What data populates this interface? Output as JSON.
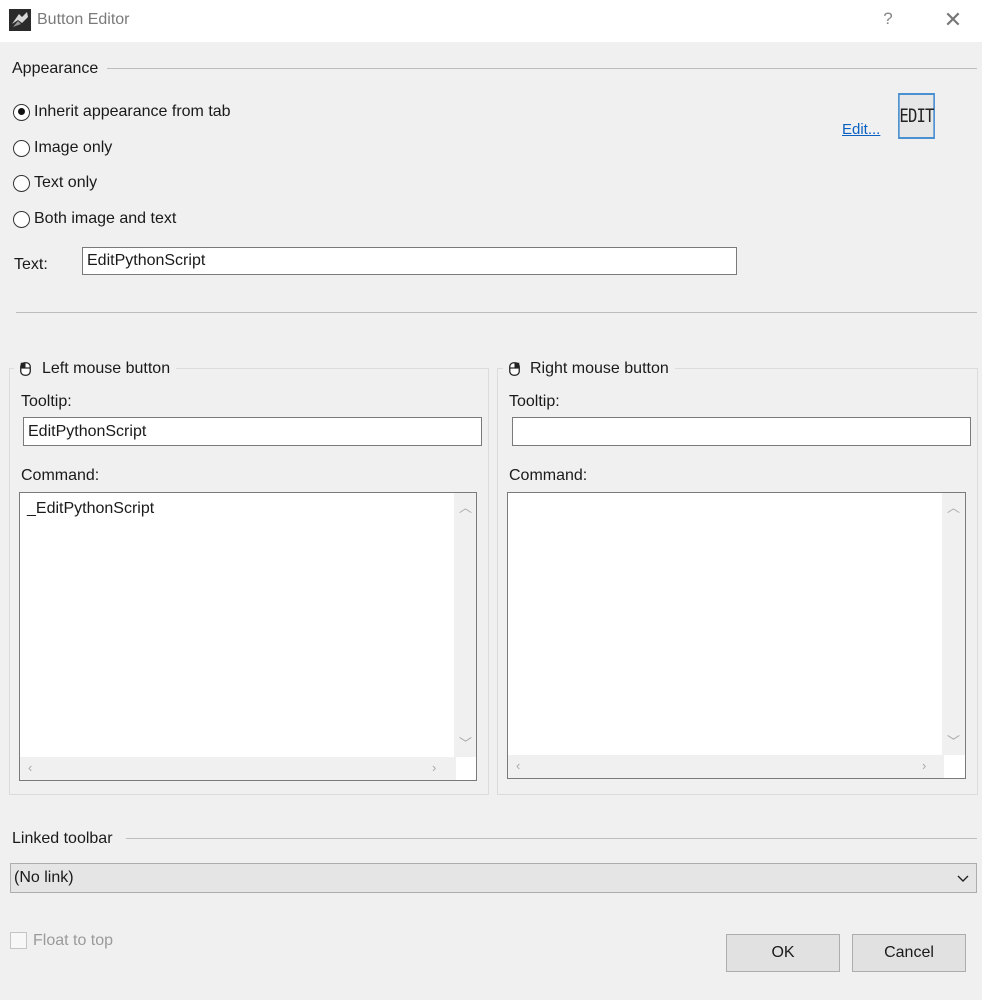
{
  "window": {
    "title": "Button Editor",
    "help_label": "?",
    "close_label": "✕"
  },
  "appearance": {
    "group_label": "Appearance",
    "options": [
      {
        "label": "Inherit appearance from tab",
        "checked": true
      },
      {
        "label": "Image only",
        "checked": false
      },
      {
        "label": "Text only",
        "checked": false
      },
      {
        "label": "Both image and text",
        "checked": false
      }
    ],
    "text_label": "Text:",
    "text_value": "EditPythonScript",
    "edit_link": "Edit...",
    "preview_label": "EDIT"
  },
  "left_mouse": {
    "header": "Left mouse button",
    "tooltip_label": "Tooltip:",
    "tooltip_value": "EditPythonScript",
    "command_label": "Command:",
    "command_value": "_EditPythonScript"
  },
  "right_mouse": {
    "header": "Right mouse button",
    "tooltip_label": "Tooltip:",
    "tooltip_value": "",
    "command_label": "Command:",
    "command_value": ""
  },
  "linked_toolbar": {
    "group_label": "Linked toolbar",
    "selected": "(No link)"
  },
  "float_to_top": {
    "label": "Float to top",
    "checked": false,
    "enabled": false
  },
  "buttons": {
    "ok": "OK",
    "cancel": "Cancel"
  },
  "icons": [
    "app-icon",
    "help-icon",
    "close-icon",
    "mouse-icon",
    "chevron-down-icon",
    "scroll-arrow-icons"
  ]
}
